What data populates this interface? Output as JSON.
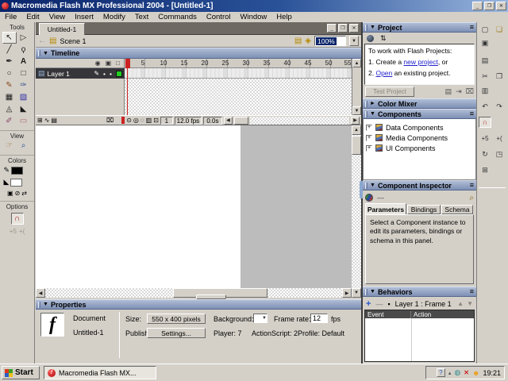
{
  "window": {
    "title": "Macromedia Flash MX Professional 2004 - [Untitled-1]"
  },
  "menu": {
    "items": [
      "File",
      "Edit",
      "View",
      "Insert",
      "Modify",
      "Text",
      "Commands",
      "Control",
      "Window",
      "Help"
    ]
  },
  "tools": {
    "section_tools": "Tools",
    "section_view": "View",
    "section_colors": "Colors",
    "section_options": "Options"
  },
  "document": {
    "tab": "Untitled-1",
    "scene": "Scene 1",
    "zoom": "100%"
  },
  "timeline": {
    "title": "Timeline",
    "layer": "Layer 1",
    "ruler": [
      "5",
      "10",
      "15",
      "20",
      "25",
      "30",
      "35",
      "40",
      "45",
      "50",
      "55"
    ],
    "current_frame": "1",
    "frame_rate": "12.0 fps",
    "elapsed_time": "0.0s"
  },
  "properties": {
    "title": "Properties",
    "doc_type": "Document",
    "doc_name": "Untitled-1",
    "size_label": "Size:",
    "size_value": "550 x 400 pixels",
    "background_label": "Background:",
    "frame_rate_label": "Frame rate:",
    "frame_rate_value": "12",
    "fps_suffix": "fps",
    "publish_label": "Publish:",
    "publish_button": "Settings...",
    "player": "Player: 7",
    "actionscript": "ActionScript: 2",
    "profile": "Profile: Default"
  },
  "project_panel": {
    "title": "Project",
    "intro": "To work with Flash Projects:",
    "line1_pre": "1. Create a ",
    "line1_link": "new project",
    "line1_post": ", or",
    "line2_pre": "2. ",
    "line2_link": "Open",
    "line2_post": " an existing project.",
    "test_button": "Test Project"
  },
  "color_mixer_panel": {
    "title": "Color Mixer"
  },
  "components_panel": {
    "title": "Components",
    "items": [
      "Data Components",
      "Media Components",
      "UI Components"
    ]
  },
  "component_inspector_panel": {
    "title": "Component Inspector",
    "tabs": [
      "Parameters",
      "Bindings",
      "Schema"
    ],
    "placeholder_dash": "—",
    "message": "Select a Component instance to edit its parameters, bindings or schema in this panel."
  },
  "behaviors_panel": {
    "title": "Behaviors",
    "context": "Layer 1 : Frame 1",
    "col_event": "Event",
    "col_action": "Action"
  },
  "taskbar": {
    "start": "Start",
    "task": "Macromedia Flash MX...",
    "clock": "19:21"
  },
  "colors": {
    "titlebar_start": "#0a246a",
    "titlebar_end": "#9ab6de",
    "chrome": "#d4d0c8",
    "panel_header_top": "#b0bdd6",
    "panel_header_bottom": "#7e90b4",
    "link": "#2222cc",
    "playhead": "#cc2222",
    "layer_selected": "#36363a",
    "stage": "#ffffff",
    "pasteboard": "#bcbcbc",
    "layer_outline_chip": "#22cc22"
  },
  "icons": {
    "minimize": "_",
    "restore": "❐",
    "close": "✕",
    "collapse": "▼",
    "expand": "►",
    "options": "≡",
    "arrow_tool": "↖",
    "subselect_tool": "▷",
    "line_tool": "╱",
    "lasso_tool": "ϙ",
    "pen_tool": "✒",
    "text_tool": "A",
    "oval_tool": "○",
    "rect_tool": "□",
    "pencil_tool": "✎",
    "brush_tool": "✑",
    "free_transform_tool": "▦",
    "fill_transform_tool": "▨",
    "ink_bottle_tool": "◬",
    "paint_bucket_tool": "◣",
    "eyedropper_tool": "✐",
    "eraser_tool": "▭",
    "hand_tool": "☞",
    "zoom_tool": "⌕",
    "stroke_pencil": "✎",
    "fill_bucket": "◣",
    "default_colors": "▣",
    "no_color": "⊘",
    "swap_colors": "⇄",
    "magnet": "∩",
    "straighten": "+5",
    "smooth": "+(",
    "back_nav": "←",
    "clapper": "▤",
    "edit_scene": "▤",
    "edit_symbol": "◈",
    "dropdown": "▼",
    "eye": "◉",
    "lock": "▣",
    "outline_box": "□",
    "layer_page": "▤",
    "layer_pencil": "✎",
    "dot": "•",
    "insert_layer": "⊞",
    "motion_guide": "∿",
    "layer_folder": "▤",
    "trash": "⌧",
    "center_frame": "⊙",
    "onion_skin": "◎",
    "onion_outline": "◌",
    "edit_multi": "▥",
    "modify_markers": "⊡",
    "up": "▲",
    "down": "▼",
    "left": "◀",
    "right": "▶",
    "end_marker": "⇥",
    "vc_ball": "",
    "sort": "⇅",
    "folder_add": "▤",
    "import": "⇥",
    "magnify": "⌕",
    "add": "+",
    "remove": "—",
    "pin": "▪",
    "new_file": "▢",
    "open_file": "❏",
    "save_file": "▣",
    "print": "▤",
    "cut": "✂",
    "copy": "❐",
    "paste": "▥",
    "undo": "↶",
    "redo": "↷",
    "rotate": "↻",
    "scale": "◳",
    "align": "⊞",
    "help_tray": "?",
    "tray_caret": "▴",
    "tray_globe": "◍",
    "tray_mute": "✕",
    "tray_user": "☻",
    "flash_f": "f"
  }
}
